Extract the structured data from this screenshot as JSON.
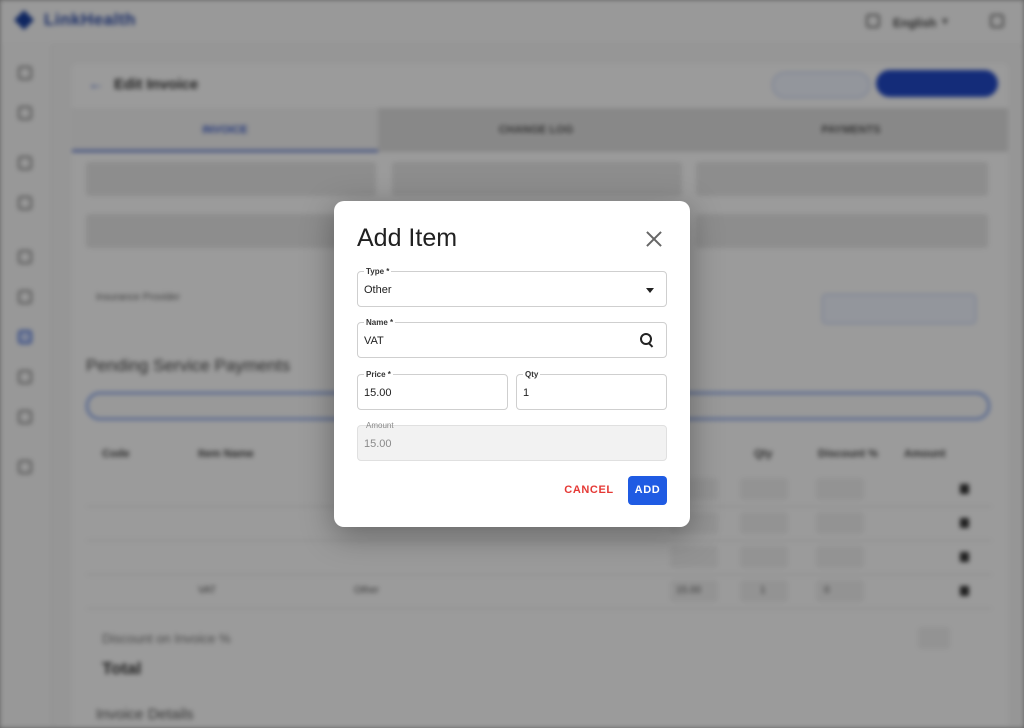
{
  "background": {
    "brand": "LinkHealth",
    "language": "English",
    "page_title": "Edit Invoice",
    "header_buttons": [
      "",
      ""
    ],
    "tabs": [
      "INVOICE",
      "CHANGE LOG",
      "PAYMENTS"
    ],
    "form_fields": [
      {
        "label": "",
        "value": ""
      },
      {
        "label": "",
        "value": ""
      },
      {
        "label": "",
        "value": ""
      },
      {
        "label": "",
        "value": ""
      },
      {
        "label": "",
        "value": ""
      }
    ],
    "insurance_label": "Insurance Provider",
    "insurance_value": "",
    "insurance_button": "",
    "pending_title": "Pending Service Payments",
    "table_headers": [
      "Code",
      "Item Name",
      "Qty",
      "Discount %",
      "Amount"
    ],
    "rows": [
      {
        "code": "",
        "name": "",
        "type": "",
        "date": "",
        "remark": "",
        "price": "",
        "qty": "",
        "discount": "",
        "amount": ""
      },
      {
        "code": "",
        "name": "",
        "type": "",
        "date": "",
        "remark": "",
        "price": "",
        "qty": "",
        "discount": "",
        "amount": ""
      },
      {
        "code": "",
        "name": "",
        "type": "",
        "date": "",
        "remark": "",
        "price": "",
        "qty": "",
        "discount": "",
        "amount": ""
      },
      {
        "code": "",
        "name": "VAT",
        "type": "Other",
        "date": "",
        "remark": "",
        "price": "15.00",
        "qty": "1",
        "discount": "0",
        "amount": ""
      }
    ],
    "discount_label": "Discount on Invoice %",
    "discount_value": "",
    "total_label": "Total",
    "total_value": "",
    "invoice_details": "Invoice Details"
  },
  "dialog": {
    "title": "Add Item",
    "type_label": "Type *",
    "type_value": "Other",
    "name_label": "Name *",
    "name_value": "VAT",
    "price_label": "Price *",
    "price_value": "15.00",
    "qty_label": "Qty",
    "qty_value": "1",
    "amount_label": "Amount",
    "amount_value": "15.00",
    "cancel_label": "CANCEL",
    "add_label": "ADD"
  },
  "colors": {
    "primary": "#1f5be3",
    "cancel": "#e53935",
    "overlay": "rgba(0,0,0,0.38)"
  },
  "icons": [
    "close-icon",
    "dropdown-caret-icon",
    "search-icon"
  ]
}
